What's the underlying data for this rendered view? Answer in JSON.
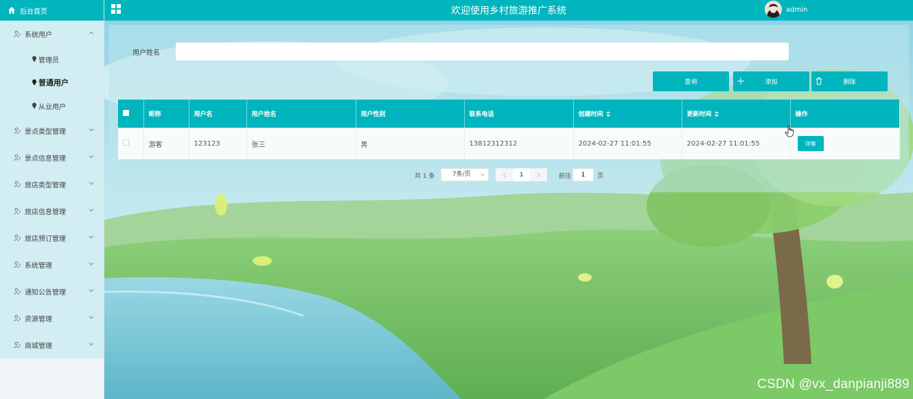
{
  "sidebar": {
    "home_label": "后台首页",
    "menu": [
      {
        "label": "系统用户",
        "expanded": true,
        "children": [
          {
            "label": "管理员",
            "active": false
          },
          {
            "label": "普通用户",
            "active": true
          },
          {
            "label": "从业用户",
            "active": false
          }
        ]
      },
      {
        "label": "景点类型管理"
      },
      {
        "label": "景点信息管理"
      },
      {
        "label": "旅店类型管理"
      },
      {
        "label": "旅店信息管理"
      },
      {
        "label": "旅店预订管理"
      },
      {
        "label": "系统管理"
      },
      {
        "label": "通知公告管理"
      },
      {
        "label": "资源管理"
      },
      {
        "label": "商城管理"
      }
    ]
  },
  "header": {
    "title": "欢迎使用乡村旅游推广系统",
    "username": "admin"
  },
  "search": {
    "label": "用户姓名",
    "value": "",
    "placeholder": ""
  },
  "actions": {
    "query": "查询",
    "add": "添加",
    "delete": "删除"
  },
  "table": {
    "columns": [
      "昵称",
      "用户名",
      "用户姓名",
      "用户性别",
      "联系电话",
      "创建时间",
      "更新时间",
      "操作"
    ],
    "rows": [
      {
        "nickname": "游客",
        "username": "123123",
        "realname": "张三",
        "gender": "男",
        "phone": "13812312312",
        "created": "2024-02-27 11:01:55",
        "updated": "2024-02-27 11:01:55",
        "action": "详情"
      }
    ]
  },
  "pagination": {
    "total": "共 1 条",
    "page_size": "7条/页",
    "current_page": "1",
    "goto_label": "前往",
    "goto_value": "1",
    "page_unit": "页"
  },
  "watermark": "CSDN @vx_danpianji889",
  "colors": {
    "accent": "#00b5bd",
    "sidebar_bg": "#d2eef3"
  }
}
